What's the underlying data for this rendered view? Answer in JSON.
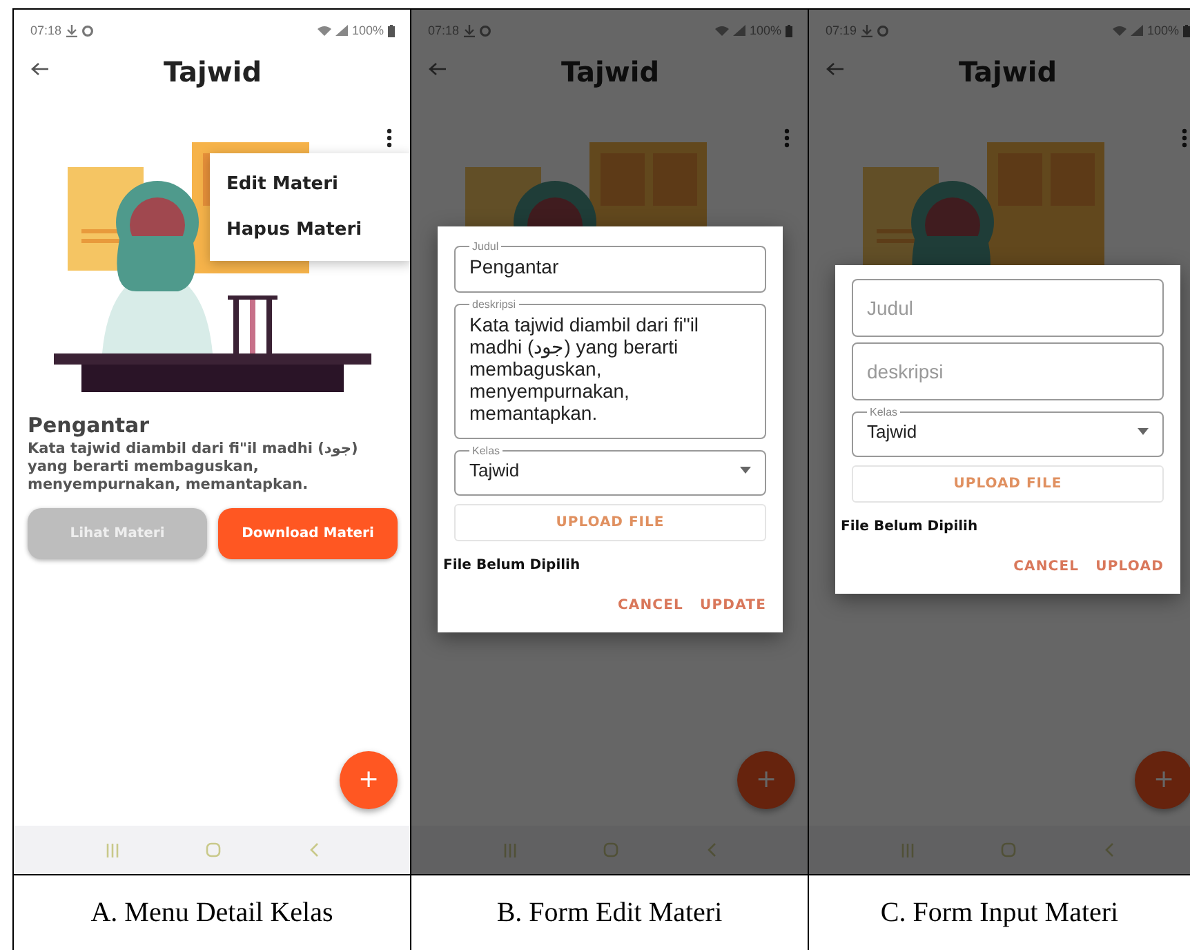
{
  "panels": [
    {
      "status_bar": {
        "time": "07:18",
        "battery": "100%"
      },
      "title": "Tajwid",
      "dimmed": false,
      "menu": [
        {
          "label": "Edit Materi"
        },
        {
          "label": "Hapus Materi"
        }
      ],
      "heading": "Pengantar",
      "description": "Kata tajwid diambil dari fi\"il madhi (جود) yang berarti membaguskan, menyempurnakan, memantapkan.",
      "buttons": [
        {
          "label": "Lihat Materi",
          "disabled": true
        },
        {
          "label": "Download Materi",
          "disabled": false
        }
      ],
      "fab": "+",
      "caption": "A. Menu Detail Kelas"
    },
    {
      "status_bar": {
        "time": "07:18",
        "battery": "100%"
      },
      "title": "Tajwid",
      "dimmed": true,
      "dialog": {
        "fields": [
          {
            "kind": "text",
            "label": "Judul",
            "value": "Pengantar"
          },
          {
            "kind": "textarea",
            "label": "deskripsi",
            "value": "Kata tajwid diambil dari fi\"il madhi (جود) yang berarti membaguskan, menyempurnakan, memantapkan."
          },
          {
            "kind": "select",
            "label": "Kelas",
            "value": "Tajwid"
          }
        ],
        "upload_button": "UPLOAD FILE",
        "file_status": "File Belum Dipilih",
        "actions": [
          "CANCEL",
          "UPDATE"
        ]
      },
      "fab": "+",
      "caption": "B. Form Edit Materi"
    },
    {
      "status_bar": {
        "time": "07:19",
        "battery": "100%"
      },
      "title": "Tajwid",
      "dimmed": true,
      "dialog": {
        "fields": [
          {
            "kind": "text",
            "placeholder": "Judul"
          },
          {
            "kind": "textarea",
            "placeholder": "deskripsi"
          },
          {
            "kind": "select",
            "label": "Kelas",
            "value": "Tajwid"
          }
        ],
        "upload_button": "UPLOAD FILE",
        "file_status": "File Belum Dipilih",
        "actions": [
          "CANCEL",
          "UPLOAD"
        ]
      },
      "fab": "+",
      "caption": "C. Form Input Materi"
    }
  ]
}
